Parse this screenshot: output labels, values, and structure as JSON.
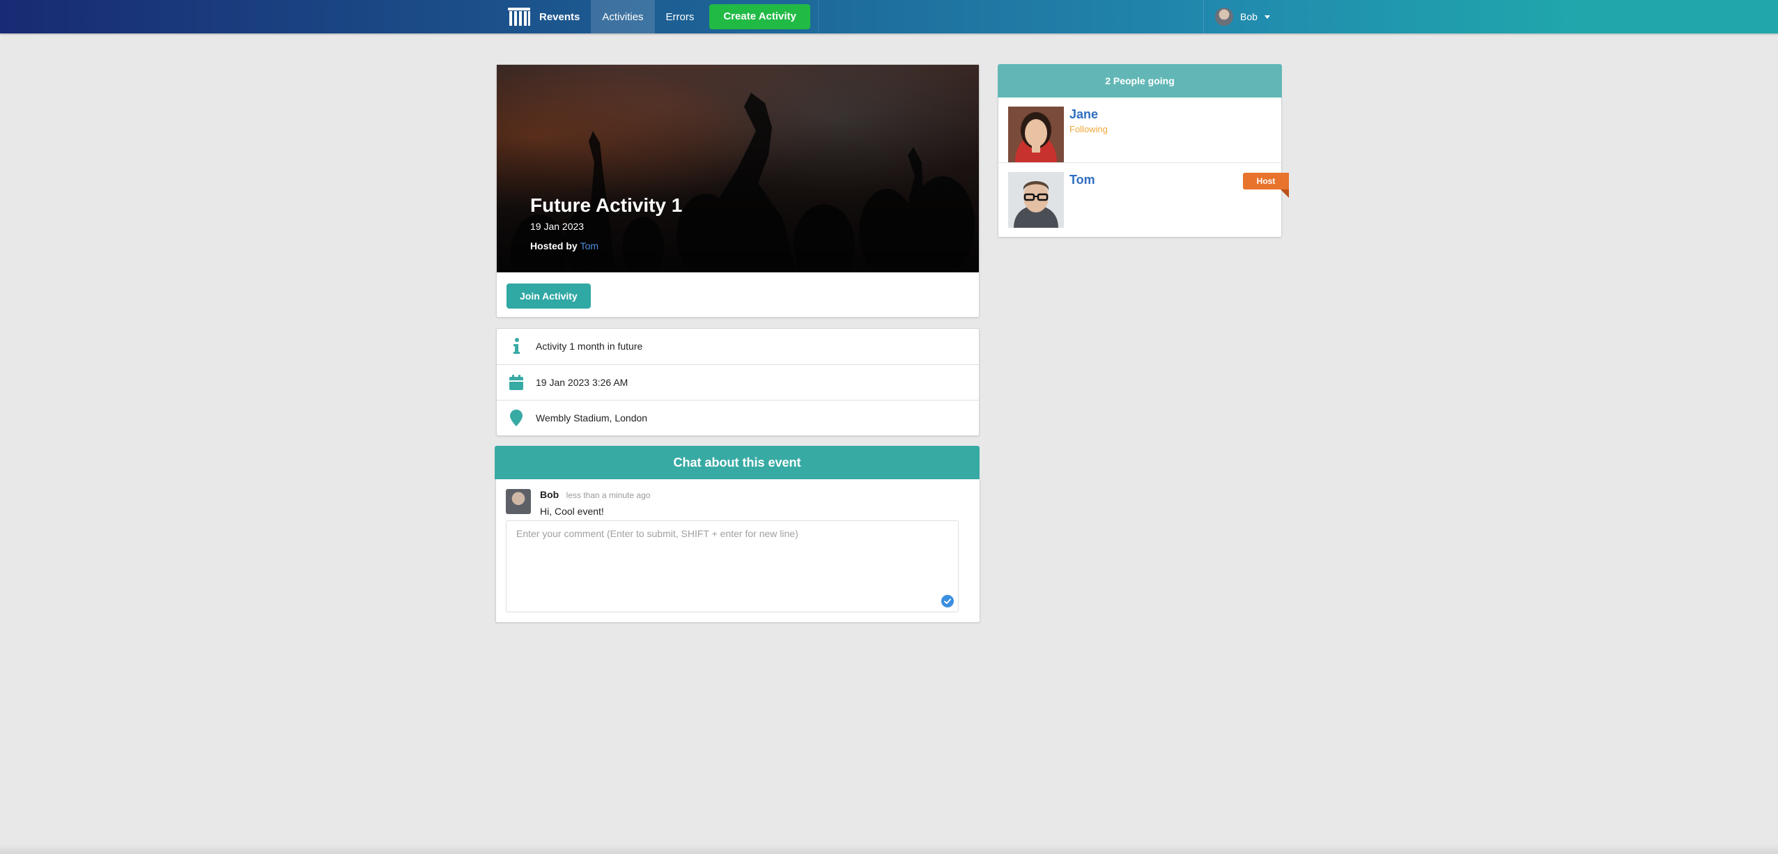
{
  "navbar": {
    "brand": "Revents",
    "items": [
      {
        "label": "Activities",
        "active": true
      },
      {
        "label": "Errors",
        "active": false
      }
    ],
    "create_button": "Create Activity",
    "user": {
      "name": "Bob"
    }
  },
  "activity": {
    "title": "Future Activity 1",
    "date": "19 Jan 2023",
    "hosted_by_label": "Hosted by",
    "host": "Tom",
    "join_button": "Join Activity",
    "details": {
      "description": "Activity 1 month in future",
      "datetime": "19 Jan 2023 3:26 AM",
      "venue": "Wembly Stadium, London"
    }
  },
  "chat": {
    "header": "Chat about this event",
    "comments": [
      {
        "author": "Bob",
        "time": "less than a minute ago",
        "text": "Hi, Cool event!"
      }
    ],
    "input_placeholder": "Enter your comment (Enter to submit, SHIFT + enter for new line)"
  },
  "attendees": {
    "header": "2 People going",
    "people": [
      {
        "name": "Jane",
        "status": "Following",
        "is_host": false
      },
      {
        "name": "Tom",
        "status": "",
        "is_host": true
      }
    ],
    "host_label": "Host"
  },
  "colors": {
    "teal": "#38aaa4",
    "green": "#21ba45",
    "host_orange": "#e8732d",
    "following_orange": "#f2a73b",
    "link_blue": "#2f6ec0"
  }
}
